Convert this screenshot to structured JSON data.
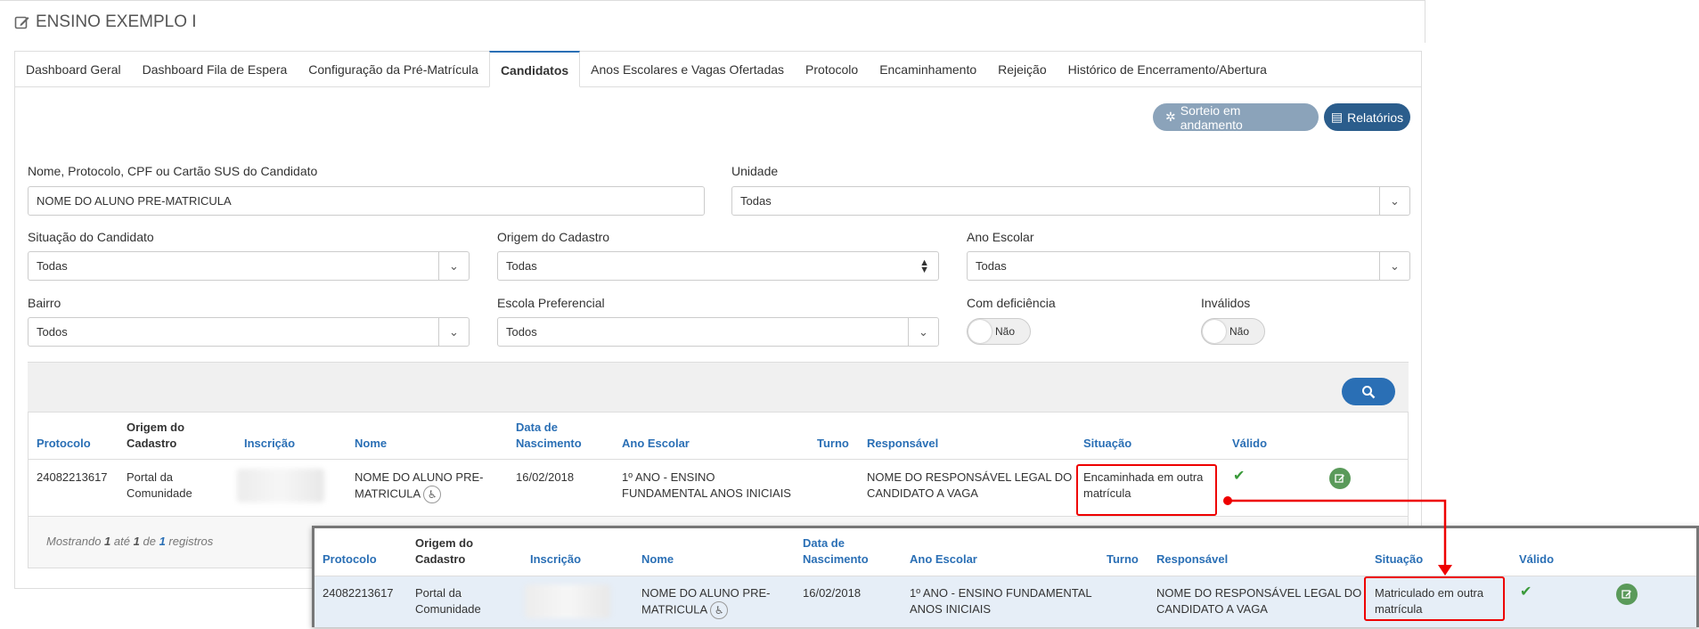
{
  "page": {
    "title": "ENSINO EXEMPLO I"
  },
  "tabs": [
    {
      "label": "Dashboard Geral"
    },
    {
      "label": "Dashboard Fila de Espera"
    },
    {
      "label": "Configuração da Pré-Matrícula"
    },
    {
      "label": "Candidatos"
    },
    {
      "label": "Anos Escolares e Vagas Ofertadas"
    },
    {
      "label": "Protocolo"
    },
    {
      "label": "Encaminhamento"
    },
    {
      "label": "Rejeição"
    },
    {
      "label": "Histórico de Encerramento/Abertura"
    }
  ],
  "actions": {
    "sorteio": "Sorteio em andamento",
    "relatorios": "Relatórios"
  },
  "filters": {
    "nome_label": "Nome, Protocolo, CPF ou Cartão SUS do Candidato",
    "nome_value": "NOME DO ALUNO PRE-MATRICULA",
    "unidade_label": "Unidade",
    "unidade_value": "Todas",
    "situacao_label": "Situação do Candidato",
    "situacao_value": "Todas",
    "origem_label": "Origem do Cadastro",
    "origem_value": "Todas",
    "ano_label": "Ano Escolar",
    "ano_value": "Todas",
    "bairro_label": "Bairro",
    "bairro_value": "Todos",
    "escola_label": "Escola Preferencial",
    "escola_value": "Todos",
    "deficiencia_label": "Com deficiência",
    "deficiencia_value": "Não",
    "invalidos_label": "Inválidos",
    "invalidos_value": "Não"
  },
  "table": {
    "headers": {
      "protocolo": "Protocolo",
      "origem_1": "Origem do",
      "origem_2": "Cadastro",
      "inscricao": "Inscrição",
      "nome": "Nome",
      "data_1": "Data de",
      "data_2": "Nascimento",
      "ano": "Ano Escolar",
      "turno": "Turno",
      "responsavel": "Responsável",
      "situacao": "Situação",
      "valido": "Válido"
    },
    "row": {
      "protocolo": "24082213617",
      "origem_1": "Portal da",
      "origem_2": "Comunidade",
      "nome_1": "NOME DO ALUNO PRE-",
      "nome_2": "MATRICULA",
      "data": "16/02/2018",
      "ano_1": "1º ANO - ENSINO",
      "ano_2": "FUNDAMENTAL ANOS INICIAIS",
      "responsavel_1": "NOME DO RESPONSÁVEL LEGAL DO",
      "responsavel_2": "CANDIDATO A VAGA",
      "situacao_1": "Encaminhada em outra",
      "situacao_2": "matrícula"
    },
    "footer": {
      "prefix": "Mostrando",
      "from": "1",
      "ate": "até",
      "to": "1",
      "de": "de",
      "total": "1",
      "suffix": "registros"
    }
  },
  "overlay_row": {
    "protocolo": "24082213617",
    "origem_1": "Portal da",
    "origem_2": "Comunidade",
    "nome_1": "NOME DO ALUNO PRE-",
    "nome_2": "MATRICULA",
    "data": "16/02/2018",
    "ano_1": "1º ANO - ENSINO FUNDAMENTAL",
    "ano_2": "ANOS INICIAIS",
    "responsavel_1": "NOME DO RESPONSÁVEL LEGAL DO",
    "responsavel_2": "CANDIDATO A VAGA",
    "situacao_1": "Matriculado em outra",
    "situacao_2": "matrícula"
  },
  "colors": {
    "accent": "#2a6fb5",
    "highlight": "#e00000",
    "valid": "#3a9a3a"
  }
}
